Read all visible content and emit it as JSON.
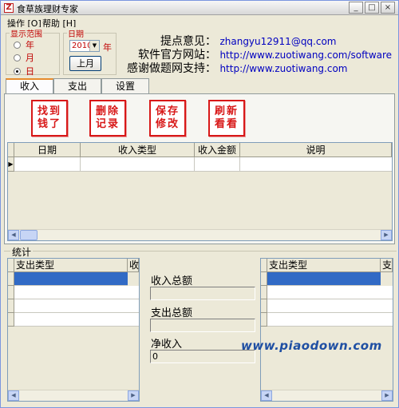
{
  "window": {
    "title": "食草族理财专家",
    "app_icon_glyph": "Z",
    "controls": {
      "minimize": "_",
      "maximize": "□",
      "close": "×"
    }
  },
  "menu": [
    {
      "label": "操作 [O]"
    },
    {
      "label": "帮助 [H]"
    }
  ],
  "display_range": {
    "title": "显示范围",
    "options": [
      {
        "label": "年",
        "checked": false
      },
      {
        "label": "月",
        "checked": false
      },
      {
        "label": "日",
        "checked": true
      }
    ]
  },
  "date": {
    "title": "日期",
    "year_value": "2010",
    "year_label": "年",
    "prev_month_button": "上月"
  },
  "info": {
    "feedback_label": "提点意见：",
    "feedback_value": "zhangyu12911@qq.com",
    "website_label": "软件官方网站：",
    "website_value": "http://www.zuotiwang.com/software",
    "thanks_label": "感谢做题网支持：",
    "thanks_value": "http://www.zuotiwang.com"
  },
  "tabs": [
    {
      "label": "收入",
      "active": true
    },
    {
      "label": "支出",
      "active": false
    },
    {
      "label": "设置",
      "active": false
    }
  ],
  "actions": [
    {
      "line1": "找到",
      "line2": "钱了"
    },
    {
      "line1": "删除",
      "line2": "记录"
    },
    {
      "line1": "保存",
      "line2": "修改"
    },
    {
      "line1": "刷新",
      "line2": "看看"
    }
  ],
  "income_table": {
    "columns": [
      "日期",
      "收入类型",
      "收入金额",
      "说明"
    ],
    "row_indicator": "▶"
  },
  "stats": {
    "title": "统计",
    "left_grid_headers": [
      "支出类型",
      "收"
    ],
    "right_grid_headers": [
      "支出类型",
      "支"
    ],
    "income_total_label": "收入总额",
    "income_total_value": "",
    "expense_total_label": "支出总额",
    "expense_total_value": "",
    "net_income_label": "净收入",
    "net_income_value": "0"
  },
  "watermark": "www.piaodown.com",
  "colors": {
    "accent_red": "#d81818",
    "link_blue": "#0000c0",
    "selection_blue": "#316ac5"
  }
}
